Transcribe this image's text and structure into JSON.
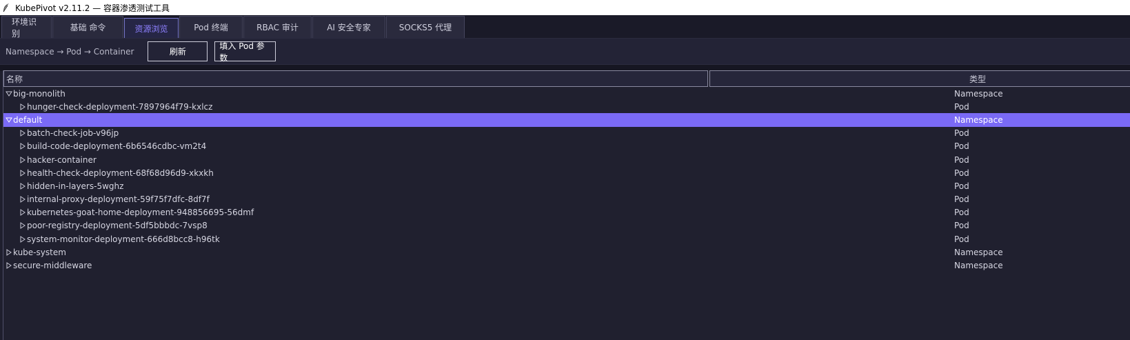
{
  "window": {
    "title": "KubePivot  v2.11.2 — 容器渗透测试工具"
  },
  "tabs": [
    {
      "label": "环境识别",
      "active": false
    },
    {
      "label": "基础 命令",
      "active": false
    },
    {
      "label": "资源浏览",
      "active": true
    },
    {
      "label": "Pod 终端",
      "active": false
    },
    {
      "label": "RBAC 审计",
      "active": false
    },
    {
      "label": "AI 安全专家",
      "active": false
    },
    {
      "label": "SOCKS5 代理",
      "active": false
    }
  ],
  "toolbar": {
    "hint": "Namespace → Pod → Container",
    "refresh_label": "刷新",
    "fill_label": "填入 Pod 参数"
  },
  "tree": {
    "columns": {
      "name": "名称",
      "type": "类型"
    },
    "rows": [
      {
        "name": "big-monolith",
        "type": "Namespace",
        "level": 0,
        "expanded": true,
        "selected": false
      },
      {
        "name": "hunger-check-deployment-7897964f79-kxlcz",
        "type": "Pod",
        "level": 1,
        "expanded": false,
        "selected": false
      },
      {
        "name": "default",
        "type": "Namespace",
        "level": 0,
        "expanded": true,
        "selected": true
      },
      {
        "name": "batch-check-job-v96jp",
        "type": "Pod",
        "level": 1,
        "expanded": false,
        "selected": false
      },
      {
        "name": "build-code-deployment-6b6546cdbc-vm2t4",
        "type": "Pod",
        "level": 1,
        "expanded": false,
        "selected": false
      },
      {
        "name": "hacker-container",
        "type": "Pod",
        "level": 1,
        "expanded": false,
        "selected": false
      },
      {
        "name": "health-check-deployment-68f68d96d9-xkxkh",
        "type": "Pod",
        "level": 1,
        "expanded": false,
        "selected": false
      },
      {
        "name": "hidden-in-layers-5wghz",
        "type": "Pod",
        "level": 1,
        "expanded": false,
        "selected": false
      },
      {
        "name": "internal-proxy-deployment-59f75f7dfc-8df7f",
        "type": "Pod",
        "level": 1,
        "expanded": false,
        "selected": false
      },
      {
        "name": "kubernetes-goat-home-deployment-948856695-56dmf",
        "type": "Pod",
        "level": 1,
        "expanded": false,
        "selected": false
      },
      {
        "name": "poor-registry-deployment-5df5bbbdc-7vsp8",
        "type": "Pod",
        "level": 1,
        "expanded": false,
        "selected": false
      },
      {
        "name": "system-monitor-deployment-666d8bcc8-h96tk",
        "type": "Pod",
        "level": 1,
        "expanded": false,
        "selected": false
      },
      {
        "name": "kube-system",
        "type": "Namespace",
        "level": 0,
        "expanded": false,
        "selected": false
      },
      {
        "name": "secure-middleware",
        "type": "Namespace",
        "level": 0,
        "expanded": false,
        "selected": false
      }
    ]
  },
  "colors": {
    "accent": "#7a6af5",
    "active_tab_text": "#8e80ff",
    "background": "#1f1f2e"
  }
}
